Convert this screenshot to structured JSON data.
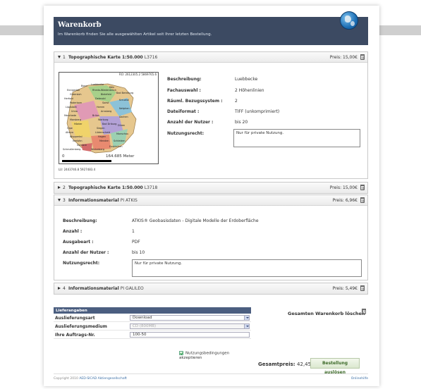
{
  "header": {
    "title": "Warenkorb",
    "subtitle": "Im Warenkorb finden Sie alle ausgewählten Artikel seit Ihrer letzten Bestellung."
  },
  "items": [
    {
      "num": "1",
      "name": "Topographische Karte 1:50.000",
      "code": "L3716",
      "price": "Preis: 15,00€",
      "expanded": true,
      "map": {
        "ro": "RO: 2612305.2 5869765.6",
        "lu": "LU: 2443746.8 5927483.4",
        "scale_start": "0",
        "scale_end": "164.685 Meter",
        "place_names": [
          "Luebbecke",
          "Ennigerloh",
          "Rheda-Wiedenbrück",
          "Gütersloh",
          "Bielefeld",
          "Herford",
          "Detmold",
          "Paderborn",
          "Soest",
          "Lippstadt",
          "Hamm",
          "Unna",
          "Arnsberg",
          "Meschede",
          "Brilon",
          "Marsberg",
          "Warburg",
          "Höxter",
          "Bad Driburg",
          "Olpe",
          "Siegen",
          "Altena",
          "Lüdenscheid",
          "Wuppertal",
          "Hagen",
          "Iserlohn",
          "Menden",
          "Sundern",
          "Schmallenberg",
          "Winterberg",
          "Bad Berleburg",
          "Kreuztal",
          "Netphen",
          "Aachen",
          "Düren",
          "Monschau",
          "Schleiden",
          "Euskirchen",
          "Bonn",
          "Köln"
        ]
      },
      "fields": [
        {
          "label": "Beschreibung:",
          "value": "Luebbecke"
        },
        {
          "label": "Fachauswahl :",
          "value": "2 Höhenlinien"
        },
        {
          "label": "Räuml. Bezugssystem :",
          "value": "2"
        },
        {
          "label": "Dateiformat :",
          "value": "TIFF (unkomprimiert)"
        },
        {
          "label": "Anzahl der Nutzer :",
          "value": "bis 20"
        },
        {
          "label": "Nutzungsrecht:",
          "value": "Nur für private Nutzung."
        }
      ]
    },
    {
      "num": "2",
      "name": "Topographische Karte 1:50.000",
      "code": "L3718",
      "price": "Preis: 15,00€",
      "expanded": false
    },
    {
      "num": "3",
      "name": "Informationsmaterial",
      "code": "PI ATKIS",
      "price": "Preis: 6,96€",
      "expanded": true,
      "fields": [
        {
          "label": "Beschreibung:",
          "value": "ATKIS® Geobasisdaten - Digitale Modelle der Erdoberfläche"
        },
        {
          "label": "Anzahl :",
          "value": "1"
        },
        {
          "label": "Ausgabeart :",
          "value": "PDF"
        },
        {
          "label": "Anzahl der Nutzer :",
          "value": "bis 10"
        },
        {
          "label": "Nutzungsrecht:",
          "value": "Nur für private Nutzung."
        }
      ]
    },
    {
      "num": "4",
      "name": "Informationsmaterial",
      "code": "PI GALILEO",
      "price": "Preis: 5,49€",
      "expanded": false
    }
  ],
  "delivery": {
    "header": "Lieferangaben",
    "rows": [
      {
        "label": "Auslieferungsart",
        "value": "Download",
        "disabled": false,
        "dropdown": true
      },
      {
        "label": "Auslieferungsmedium",
        "value": "CD (800MB)",
        "disabled": true,
        "dropdown": true
      },
      {
        "label": "Ihre Auftrags-Nr.",
        "value": "100-50",
        "disabled": false,
        "dropdown": false
      }
    ],
    "terms_label": "Nutzungsbedingungen akzeptieren",
    "terms_checked": true
  },
  "clear_cart_label": "Gesamten Warenkorb löschen",
  "total": {
    "label": "Gesamtpreis:",
    "value": "42,45€"
  },
  "order_button": "Bestellung auslösen",
  "footer": {
    "copyright_prefix": "Copyright 2010",
    "company": "AED-SICAD Aktiengesellschaft",
    "help": "Onlinehilfe"
  },
  "colors": {
    "header_bg": "#3c4a62",
    "delivery_header_bg": "#4b5e80",
    "order_button_text": "#3e6b2a"
  }
}
